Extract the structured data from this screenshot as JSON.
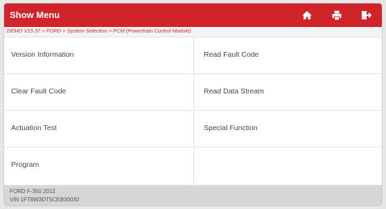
{
  "header": {
    "title": "Show Menu",
    "background_color": "#d1232a",
    "icons": [
      "home-icon",
      "print-icon",
      "exit-icon"
    ]
  },
  "breadcrumb": {
    "text": "DEMO V15.37 > FORD > System Selection > PCM (Powertrain Control Module)"
  },
  "menu": {
    "items": [
      {
        "label": "Version Information"
      },
      {
        "label": "Read Fault Code"
      },
      {
        "label": "Clear Fault Code"
      },
      {
        "label": "Read Data Stream"
      },
      {
        "label": "Actuation Test"
      },
      {
        "label": "Special Function"
      },
      {
        "label": "Program"
      }
    ]
  },
  "footer": {
    "vehicle": "FORD F-350 2012",
    "vin": "VIN 1FT8W3DT5CEB00030"
  }
}
